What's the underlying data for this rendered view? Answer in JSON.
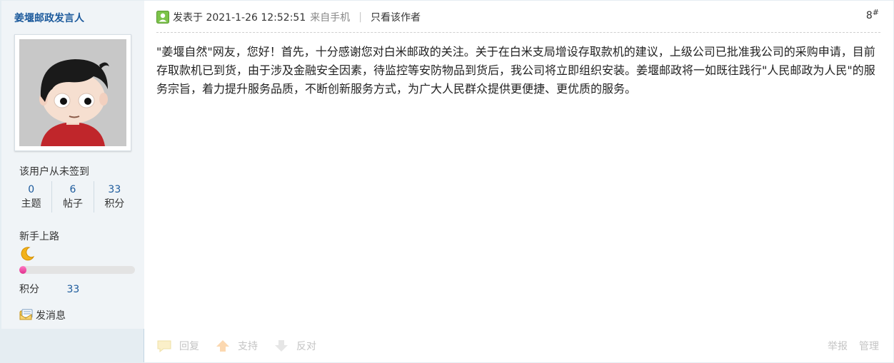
{
  "author": {
    "name": "姜堰邮政发言人",
    "sign_status": "该用户从未签到",
    "stats": [
      {
        "value": "0",
        "label": "主题"
      },
      {
        "value": "6",
        "label": "帖子"
      },
      {
        "value": "33",
        "label": "积分"
      }
    ],
    "rank_title": "新手上路",
    "rank_icon": "moon-icon",
    "rank_progress_percent": 6,
    "score_label": "积分",
    "score_value": "33",
    "send_message": "发消息"
  },
  "post": {
    "posted_at": "发表于 2021-1-26 12:52:51",
    "source": "来自手机",
    "separator": "|",
    "only_author": "只看该作者",
    "floor_number": "8",
    "floor_mark": "#",
    "content": "\"姜堰自然\"网友，您好！首先，十分感谢您对白米邮政的关注。关于在白米支局增设存取款机的建议，上级公司已批准我公司的采购申请，目前存取款机已到货，由于涉及金融安全因素，待监控等安防物品到货后，我公司将立即组织安装。姜堰邮政将一如既往践行\"人民邮政为人民\"的服务宗旨，着力提升服务品质，不断创新服务方式，为广大人民群众提供更便捷、更优质的服务。"
  },
  "actions": {
    "reply": "回复",
    "support": "支持",
    "oppose": "反对",
    "report": "举报",
    "manage": "管理"
  },
  "colors": {
    "accent_link": "#1c5a9c",
    "sidebar_bg": "#e5edf2",
    "progress": "#e02f8d"
  }
}
